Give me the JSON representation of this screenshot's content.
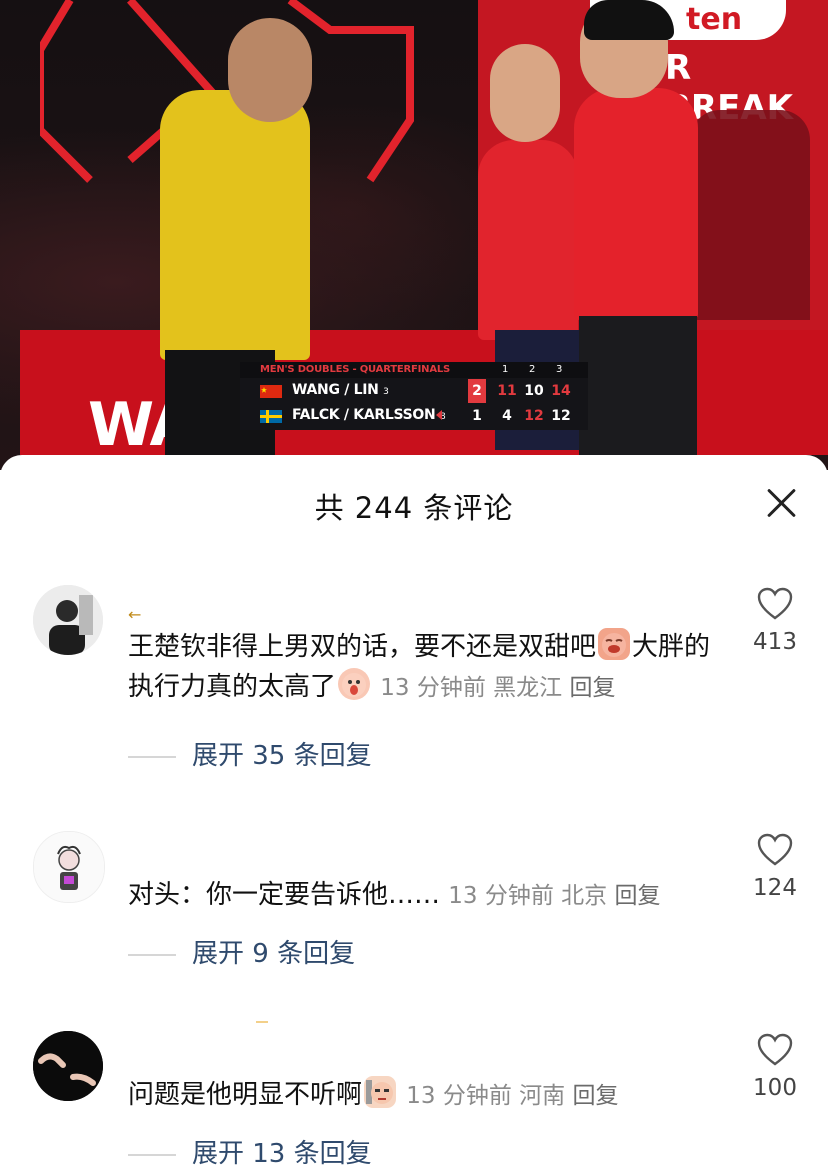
{
  "video": {
    "sponsor_logo": "ten",
    "sponsor_tagline": "R BREAK",
    "arena_board_text": "WA",
    "scoreboard": {
      "event": "MEN'S DOUBLES - QUARTERFINALS",
      "set_headers": [
        "1",
        "2",
        "3"
      ],
      "teams": [
        {
          "name": "WANG / LIN",
          "seed": "3",
          "flag": "china-flag",
          "sets_won": "2",
          "games": [
            "11",
            "10",
            "14"
          ],
          "game_colors": [
            "#e23a3f",
            "#ffffff",
            "#e23a3f"
          ]
        },
        {
          "name": "FALCK / KARLSSON",
          "seed": "8",
          "flag": "sweden-flag",
          "sets_won": "1",
          "games": [
            "4",
            "12",
            "12"
          ],
          "game_colors": [
            "#ffffff",
            "#e23a3f",
            "#ffffff"
          ]
        }
      ]
    }
  },
  "sheet": {
    "title": "共 244 条评论",
    "close_icon": "close-icon"
  },
  "comments": [
    {
      "badge": "←",
      "text_part1": "王楚钦非得上男双的话，要不还是双甜吧",
      "emoji1": "crying-face-emoji",
      "text_part2": "大胖的执行力真的太高了",
      "emoji2": "shocked-face-emoji",
      "time": "13 分钟前",
      "location": "黑龙江",
      "reply": "回复",
      "likes": "413",
      "expand": "展开 35 条回复"
    },
    {
      "badge": "",
      "text_part1": "对头：你一定要告诉他……",
      "time": "13 分钟前",
      "location": "北京",
      "reply": "回复",
      "likes": "124",
      "expand": "展开 9 条回复"
    },
    {
      "badge": "",
      "text_part1": "问题是他明显不听啊",
      "emoji1": "speechless-face-emoji",
      "time": "13 分钟前",
      "location": "河南",
      "reply": "回复",
      "likes": "100",
      "expand": "展开 13 条回复"
    }
  ]
}
